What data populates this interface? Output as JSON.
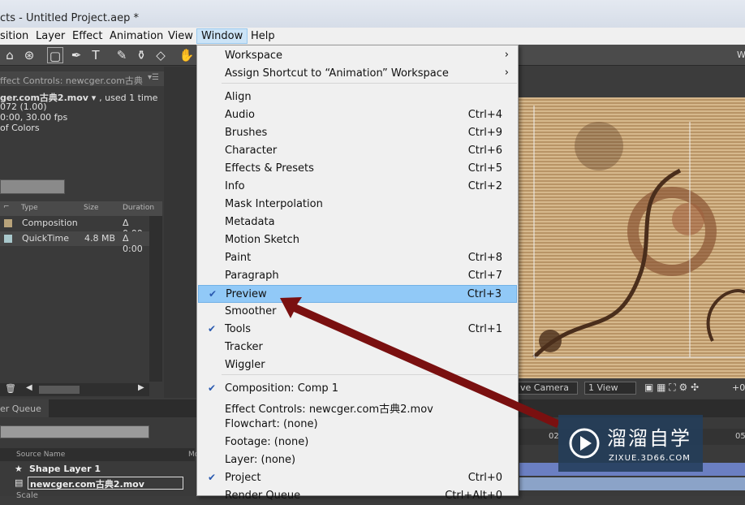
{
  "app": {
    "title": "cts - Untitled Project.aep *"
  },
  "menubar": {
    "items": [
      "sition",
      "Layer",
      "Effect",
      "Animation",
      "View",
      "Window",
      "Help"
    ]
  },
  "toolbar": {
    "right_label": "W"
  },
  "left_panel": {
    "tab_label": "ffect Controls: newcger.com古典",
    "file_name": "ger.com古典2.mov",
    "used": ", used 1 time",
    "line1": "072 (1.00)",
    "line2": "0:00, 30.00 fps",
    "line3": "of Colors",
    "columns": [
      "Type",
      "Size",
      "Duration"
    ],
    "rows": [
      {
        "type": "Composition",
        "size": "",
        "duration": "Δ 0:00",
        "color": "#b8a37a"
      },
      {
        "type": "QuickTime",
        "size": "4.8 MB",
        "duration": "Δ 0:00",
        "color": "#a9c8cc"
      }
    ]
  },
  "viewer": {
    "camera_label": "ve Camera",
    "view_label": "1 View",
    "right_value": "+0"
  },
  "render_queue": {
    "tab": "er Queue"
  },
  "timeline": {
    "column_source": "Source Name",
    "column_m": "Mo",
    "layers": [
      "Shape Layer 1",
      "newcger.com古典2.mov",
      "Scale"
    ],
    "ruler": [
      "02",
      "05"
    ]
  },
  "window_menu": {
    "items": [
      {
        "label": "Workspace",
        "shortcut": "",
        "submenu": true,
        "checked": false
      },
      {
        "label": "Assign Shortcut to “Animation” Workspace",
        "shortcut": "",
        "submenu": true,
        "checked": false
      },
      {
        "label": "Align",
        "shortcut": "",
        "checked": false
      },
      {
        "label": "Audio",
        "shortcut": "Ctrl+4",
        "checked": false
      },
      {
        "label": "Brushes",
        "shortcut": "Ctrl+9",
        "checked": false
      },
      {
        "label": "Character",
        "shortcut": "Ctrl+6",
        "checked": false
      },
      {
        "label": "Effects & Presets",
        "shortcut": "Ctrl+5",
        "checked": false
      },
      {
        "label": "Info",
        "shortcut": "Ctrl+2",
        "checked": false
      },
      {
        "label": "Mask Interpolation",
        "shortcut": "",
        "checked": false
      },
      {
        "label": "Metadata",
        "shortcut": "",
        "checked": false
      },
      {
        "label": "Motion Sketch",
        "shortcut": "",
        "checked": false
      },
      {
        "label": "Paint",
        "shortcut": "Ctrl+8",
        "checked": false
      },
      {
        "label": "Paragraph",
        "shortcut": "Ctrl+7",
        "checked": false
      },
      {
        "label": "Preview",
        "shortcut": "Ctrl+3",
        "checked": true,
        "highlighted": true
      },
      {
        "label": "Smoother",
        "shortcut": "",
        "checked": false
      },
      {
        "label": "Tools",
        "shortcut": "Ctrl+1",
        "checked": true
      },
      {
        "label": "Tracker",
        "shortcut": "",
        "checked": false
      },
      {
        "label": "Wiggler",
        "shortcut": "",
        "checked": false
      },
      {
        "label": "Composition: Comp 1",
        "shortcut": "",
        "checked": true
      },
      {
        "label": "Effect Controls: newcger.com古典2.mov",
        "shortcut": "",
        "checked": false
      },
      {
        "label": "Flowchart: (none)",
        "shortcut": "",
        "checked": false
      },
      {
        "label": "Footage: (none)",
        "shortcut": "",
        "checked": false
      },
      {
        "label": "Layer: (none)",
        "shortcut": "",
        "checked": false
      },
      {
        "label": "Project",
        "shortcut": "Ctrl+0",
        "checked": true
      },
      {
        "label": "Render Queue",
        "shortcut": "Ctrl+Alt+0",
        "checked": false
      }
    ]
  },
  "watermark": {
    "title": "溜溜自学",
    "subtitle": "ZIXUE.3D66.COM"
  },
  "colors": {
    "highlight": "#91c9f7",
    "arrow": "#7a1010",
    "menu_bg": "#f0f0f0"
  }
}
